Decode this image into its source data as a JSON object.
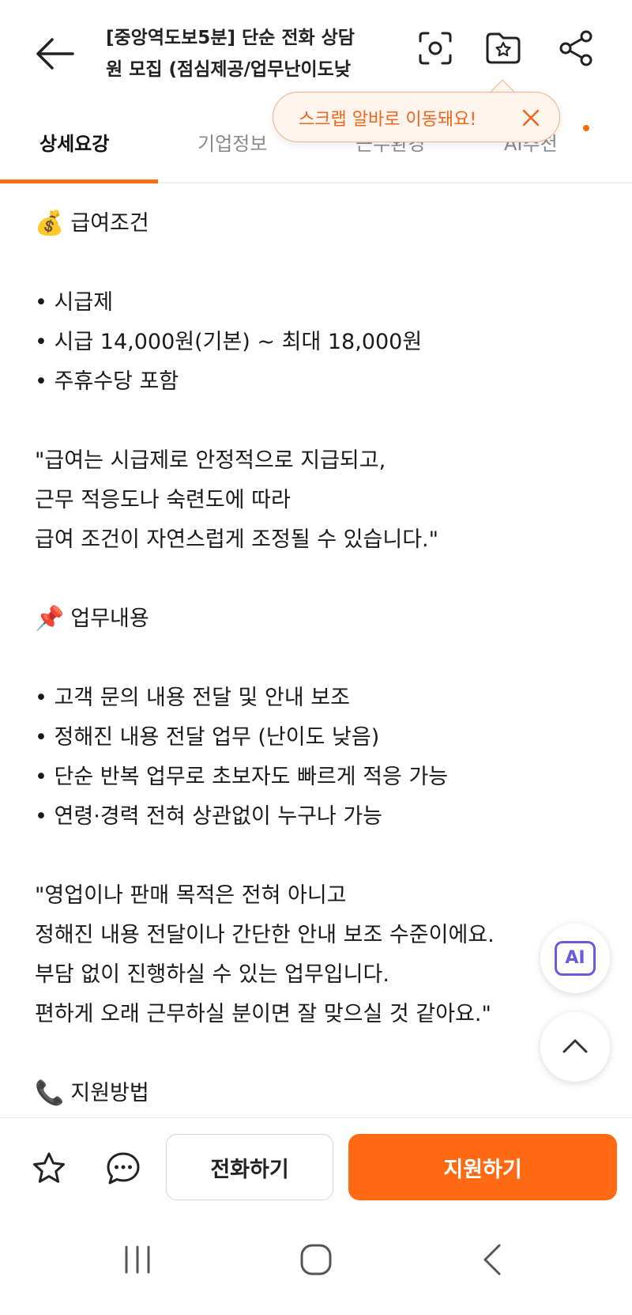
{
  "header": {
    "title_line1": "[중앙역도보5분] 단순 전화 상담",
    "title_line2": "원 모집 (점심제공/업무난이도낮",
    "icons": [
      "back-arrow-icon",
      "scan-icon",
      "scrap-folder-icon",
      "share-icon"
    ]
  },
  "tabs": [
    {
      "label": "상세요강",
      "active": true
    },
    {
      "label": "기업정보",
      "active": false
    },
    {
      "label": "근무환경",
      "active": false
    },
    {
      "label": "AI추천",
      "active": false
    }
  ],
  "tooltip": {
    "text": "스크랩 알바로 이동돼요!"
  },
  "content": {
    "salary_heading": "급여조건",
    "salary_items": [
      "• 시급제",
      "• 시급 14,000원(기본) ~ 최대 18,000원",
      "• 주휴수당 포함"
    ],
    "salary_quote": [
      "\"급여는 시급제로 안정적으로 지급되고,",
      "근무 적응도나 숙련도에 따라",
      "급여 조건이 자연스럽게 조정될 수 있습니다.\""
    ],
    "duty_heading": "업무내용",
    "duty_items": [
      "• 고객 문의 내용 전달 및 안내 보조",
      "• 정해진 내용 전달 업무 (난이도 낮음)",
      "• 단순 반복 업무로 초보자도 빠르게 적응 가능",
      "• 연령·경력 전혀 상관없이 누구나 가능"
    ],
    "duty_quote": [
      "\"영업이나 판매 목적은 전혀 아니고",
      "정해진 내용 전달이나 간단한 안내 보조 수준이에요.",
      "부담 없이 진행하실 수 있는 업무입니다.",
      "편하게 오래 근무하실 분이면 잘 맞으실 것 같아요.\""
    ],
    "apply_heading": "지원방법"
  },
  "floating": {
    "ai_label": "AI"
  },
  "bottom_bar": {
    "call_label": "전화하기",
    "apply_label": "지원하기"
  },
  "colors": {
    "accent": "#ff6a13",
    "tooltip_text": "#f0661a",
    "ai": "#6a5ae0"
  }
}
